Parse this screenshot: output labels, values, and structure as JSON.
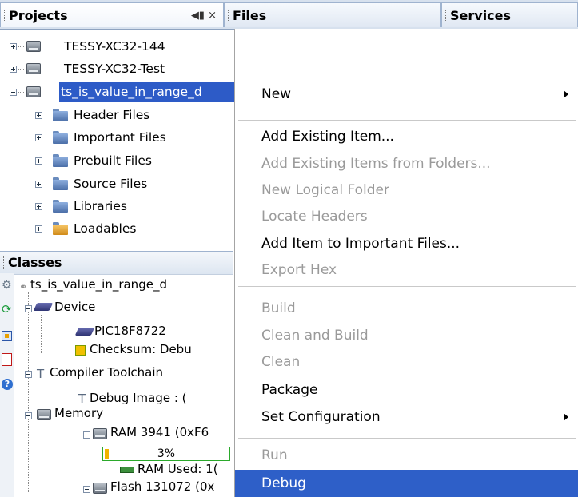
{
  "tabs": {
    "projects": "Projects",
    "files": "Files",
    "services": "Services",
    "controls": "◀▮ ×"
  },
  "projects": [
    {
      "label": "TESSY-XC32-144"
    },
    {
      "label": "TESSY-XC32-Test"
    },
    {
      "label": "ts_is_value_in_range_d"
    }
  ],
  "project_children": [
    {
      "label": "Header Files"
    },
    {
      "label": "Important Files"
    },
    {
      "label": "Prebuilt Files"
    },
    {
      "label": "Source Files"
    },
    {
      "label": "Libraries"
    },
    {
      "label": "Loadables"
    }
  ],
  "classes": {
    "title": "Classes",
    "root": "ts_is_value_in_range_d",
    "device": "Device",
    "device_name": "PIC18F8722",
    "checksum": "Checksum: Debu",
    "toolchain": "Compiler Toolchain",
    "debug_image": "Debug Image : (",
    "memory": "Memory",
    "ram": "RAM 3941 (0xF6",
    "ram_percent_text": "3%",
    "ram_percent": 3,
    "ram_used": "RAM Used: 1(",
    "flash": "Flash 131072 (0x"
  },
  "menu": {
    "new": "New",
    "add_existing": "Add Existing Item...",
    "add_from_folders": "Add Existing Items from Folders...",
    "new_logical_folder": "New Logical Folder",
    "locate_headers": "Locate Headers",
    "add_important": "Add Item to Important Files...",
    "export_hex": "Export Hex",
    "build": "Build",
    "clean_build": "Clean and Build",
    "clean": "Clean",
    "package": "Package",
    "set_configuration": "Set Configuration",
    "run": "Run",
    "debug": "Debug"
  },
  "colors": {
    "selection": "#2d5bc7",
    "menu_highlight": "#2e5fc8",
    "disabled_text": "#9a9a9a"
  }
}
